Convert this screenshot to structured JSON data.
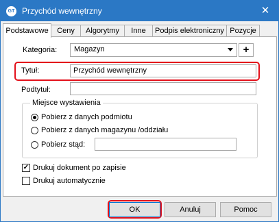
{
  "window": {
    "title": "Przychód wewnętrzny",
    "app_icon_text": "GT",
    "close_glyph": "✕"
  },
  "tabs": [
    {
      "label": "Podstawowe",
      "active": true
    },
    {
      "label": "Ceny",
      "active": false
    },
    {
      "label": "Algorytmy",
      "active": false
    },
    {
      "label": "Inne",
      "active": false
    },
    {
      "label": "Podpis elektroniczny",
      "active": false
    },
    {
      "label": "Pozycje",
      "active": false
    }
  ],
  "form": {
    "kategoria_label": "Kategoria:",
    "kategoria_value": "Magazyn",
    "add_glyph": "+",
    "tytul_label": "Tytuł:",
    "tytul_value": "Przychód wewnętrzny",
    "podtytul_label": "Podtytuł:",
    "podtytul_value": ""
  },
  "miejsce": {
    "title": "Miejsce wystawienia",
    "options": [
      {
        "label": "Pobierz z danych podmiotu",
        "selected": true
      },
      {
        "label": "Pobierz z danych magazynu /oddziału",
        "selected": false
      },
      {
        "label": "Pobierz stąd:",
        "selected": false
      }
    ],
    "custom_value": ""
  },
  "checkboxes": [
    {
      "label": "Drukuj dokument po zapisie",
      "checked": true,
      "mark": "✓"
    },
    {
      "label": "Drukuj automatycznie",
      "checked": false
    }
  ],
  "buttons": {
    "ok": "OK",
    "cancel": "Anuluj",
    "help": "Pomoc"
  },
  "colors": {
    "titlebar": "#2b78c5",
    "highlight": "#e3101a"
  }
}
